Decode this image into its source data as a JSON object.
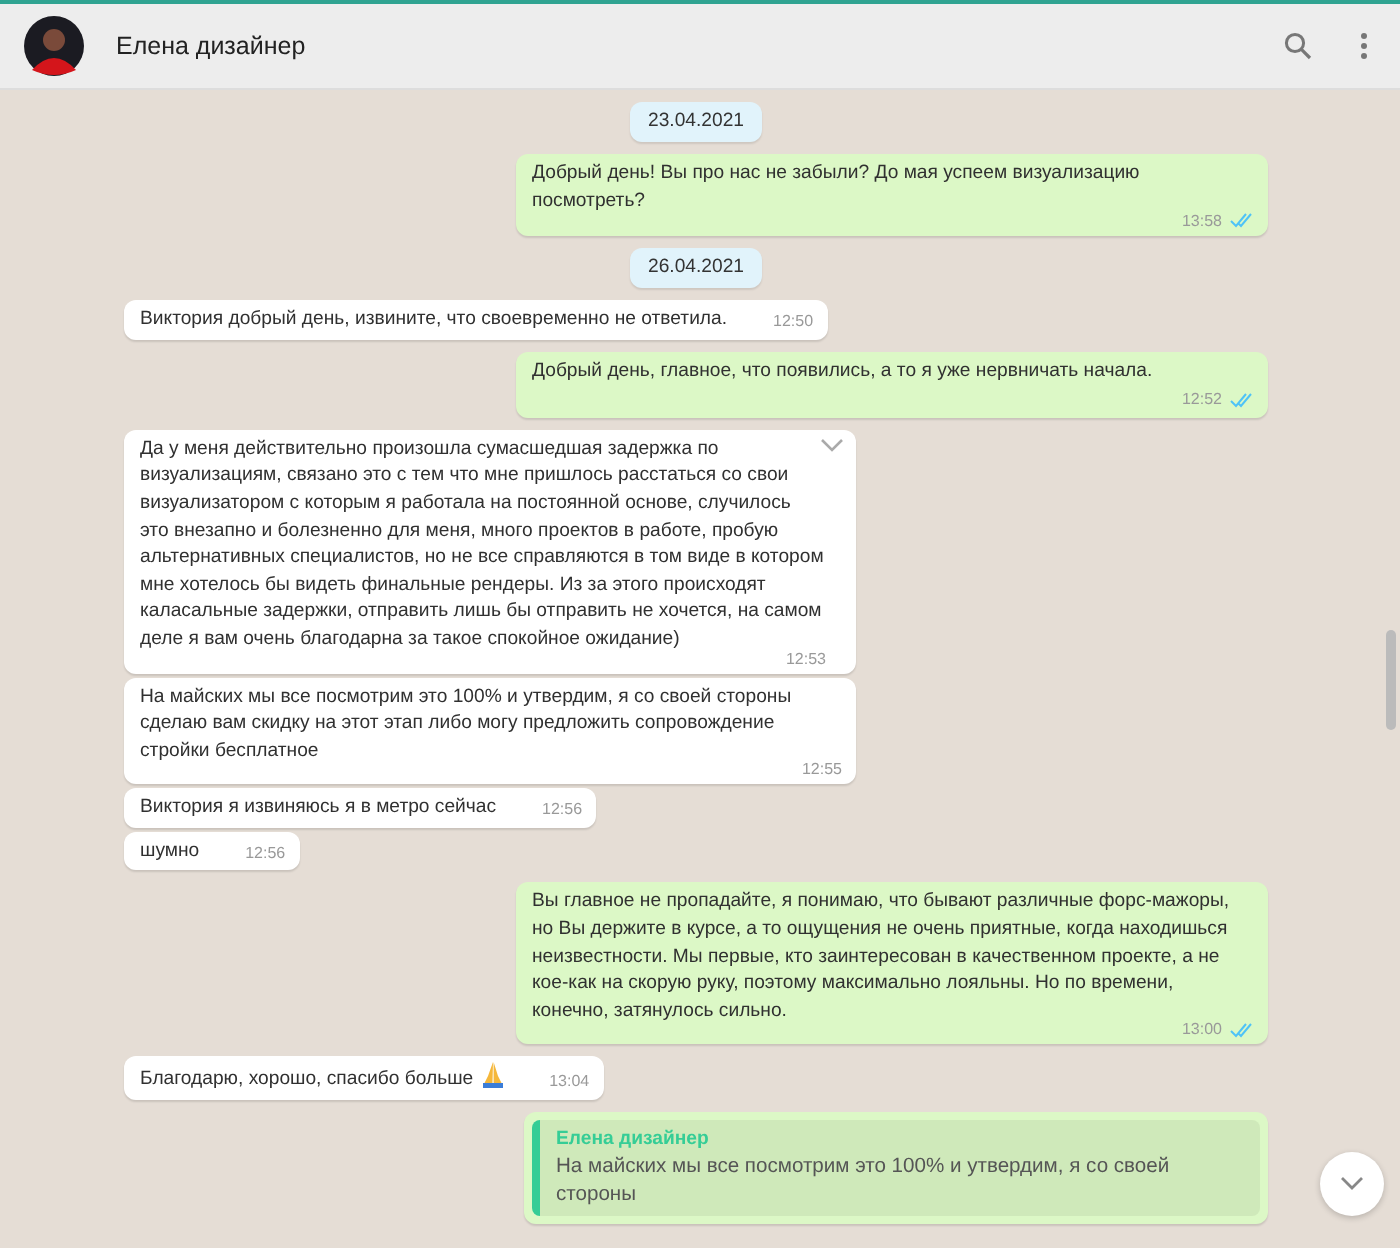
{
  "header": {
    "contact_name": "Елена дизайнер"
  },
  "messages": [
    {
      "kind": "date",
      "text": "23.04.2021"
    },
    {
      "kind": "out",
      "text": "Добрый день! Вы про нас не забыли? До мая успеем визуализацию посмотреть?",
      "time": "13:58",
      "read": true
    },
    {
      "kind": "date",
      "text": "26.04.2021"
    },
    {
      "kind": "in",
      "text": "Виктория добрый  день, извините, что своевременно не ответила.",
      "time": "12:50"
    },
    {
      "kind": "out",
      "text": "Добрый день, главное, что появились, а то я уже нервничать начала.",
      "time": "12:52",
      "read": true
    },
    {
      "kind": "in",
      "text": "Да у меня действительно произошла сумасшедшая задержка по визуализациям, связано это с тем что мне пришлось расстаться со свои визуализатором с которым я работала на постоянной основе, случилось это внезапно и болезненно для меня, много проектов в работе, пробую альтернативных специалистов, но не все справляются в том виде в котором мне хотелось бы видеть финальные рендеры. Из за этого происходят каласальные задержки, отправить лишь бы отправить не хочется, на самом деле я вам очень благодарна за такое спокойное ожидание)",
      "time": "12:53",
      "menu": true
    },
    {
      "kind": "in",
      "text": "На майских мы все посмотрим это 100% и утвердим, я со своей стороны сделаю вам скидку на этот этап либо могу предложить сопровождение стройки бесплатное",
      "time": "12:55"
    },
    {
      "kind": "in",
      "text": "Виктория я извиняюсь я в метро сейчас",
      "time": "12:56"
    },
    {
      "kind": "in",
      "text": "шумно",
      "time": "12:56"
    },
    {
      "kind": "out",
      "text": "Вы главное не пропадайте, я понимаю, что бывают различные форс-мажоры, но Вы держите в курсе, а то ощущения не очень приятные, когда находишься неизвестности. Мы первые, кто заинтересован в качественном проекте, а не кое-как на скорую руку, поэтому максимально лояльны. Но по времени, конечно, затянулось сильно.",
      "time": "13:00",
      "read": true
    },
    {
      "kind": "in",
      "text": "Благодарю, хорошо, спасибо больше",
      "time": "13:04",
      "emoji": true
    },
    {
      "kind": "reply",
      "quote_author": "Елена дизайнер",
      "quote_text": "На майских мы все посмотрим это 100% и утвердим, я со своей стороны"
    }
  ]
}
